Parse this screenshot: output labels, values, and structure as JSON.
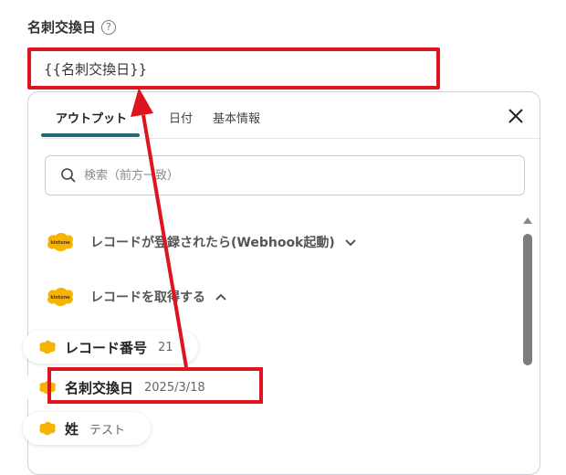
{
  "field": {
    "label": "名刺交換日",
    "help": "?",
    "value": "{{名刺交換日}}"
  },
  "tabs": [
    {
      "label": "アウトプット",
      "active": true
    },
    {
      "label": "日付",
      "active": false
    },
    {
      "label": "基本情報",
      "active": false
    }
  ],
  "search": {
    "placeholder": "検索（前方一致）"
  },
  "groups": [
    {
      "label": "レコードが登録されたら(Webhook起動)",
      "logo": "kintone",
      "state": "collapsed"
    },
    {
      "label": "レコードを取得する",
      "logo": "kintone",
      "state": "expanded"
    }
  ],
  "items": [
    {
      "name": "レコード番号",
      "value": "21"
    },
    {
      "name": "名刺交換日",
      "value": "2025/3/18"
    },
    {
      "name": "姓",
      "value": "テスト"
    }
  ],
  "colors": {
    "highlight": "#e0141e",
    "tab_accent": "#1e6b7b",
    "kintone": "#f5b400"
  }
}
